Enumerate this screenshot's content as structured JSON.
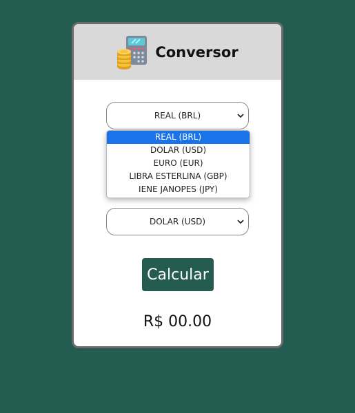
{
  "header": {
    "title": "Conversor",
    "logo_icon": "calculator-coins-icon"
  },
  "from_select": {
    "value": "REAL (BRL)",
    "expanded": true
  },
  "to_select": {
    "value": "DOLAR (USD)",
    "expanded": false
  },
  "dropdown": {
    "options": [
      {
        "label": "REAL (BRL)",
        "selected": true
      },
      {
        "label": "DOLAR (USD)",
        "selected": false
      },
      {
        "label": "EURO (EUR)",
        "selected": false
      },
      {
        "label": "LIBRA ESTERLINA (GBP)",
        "selected": false
      },
      {
        "label": "IENE JANOPES (JPY)",
        "selected": false
      }
    ]
  },
  "calculate_button": {
    "label": "Calcular"
  },
  "result": {
    "text": "R$ 00.00"
  },
  "colors": {
    "background": "#255c52",
    "header_bg": "#d9d9d9",
    "button_bg": "#255c52",
    "option_highlight": "#1a73e8"
  }
}
